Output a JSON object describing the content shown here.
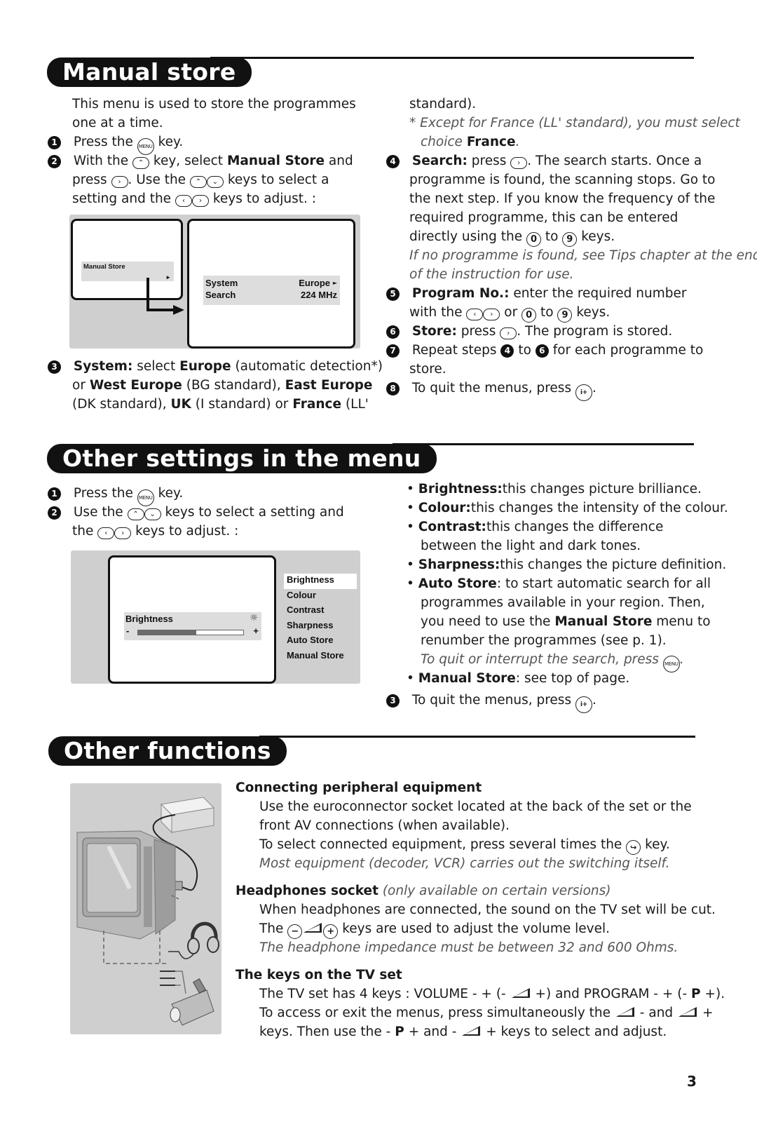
{
  "sections": {
    "manual_store": {
      "title": "Manual store",
      "intro": [
        "This menu is used to store the programmes",
        "one at a time."
      ],
      "step1": {
        "num": "1",
        "pre": "Press the",
        "key": "MENU",
        "post": "key."
      },
      "step2": {
        "num": "2",
        "line1_pre": "With the",
        "line1_mid": "key, select",
        "line1_bold": "Manual Store",
        "line1_post": "and",
        "line2_pre": "press",
        "line2_mid": ". Use the",
        "line2_post": "keys to select a",
        "line3_pre": "setting and the",
        "line3_post": "keys to adjust. :"
      },
      "diagram": {
        "left_menu_item": "Manual Store",
        "rows": [
          {
            "label": "System",
            "value": "Europe",
            "has_arrow": true
          },
          {
            "label": "Search",
            "value": "224 MHz",
            "has_arrow": false
          }
        ]
      },
      "step3": {
        "num": "3",
        "l1_b1": "System:",
        "l1_t1": "select",
        "l1_b2": "Europe",
        "l1_t2": "(automatic detection*)",
        "l2_t1": "or",
        "l2_b1": "West Europe",
        "l2_t2": "(BG standard),",
        "l2_b2": "East Europe",
        "l3_t1": "(DK standard),",
        "l3_b1": "UK",
        "l3_t2": "(I standard) or",
        "l3_b2": "France",
        "l3_t3": "(LL'",
        "l4": "standard)."
      },
      "footnote": {
        "line1": "* Except for France (LL' standard), you must select",
        "line2_pre": "choice",
        "line2_bold": "France",
        "line2_post": "."
      },
      "step4": {
        "num": "4",
        "bold": "Search:",
        "l1_pre": "press",
        "l1_post": ". The search starts. Once a",
        "l2": "programme is found, the scanning stops. Go to",
        "l3": "the next step. If you know the frequency of the",
        "l4": "required programme, this can be entered",
        "l5_pre": "directly using the",
        "key0": "0",
        "l5_mid": "to",
        "key9": "9",
        "l5_post": "keys.",
        "note1": "If no programme is found, see Tips chapter at the end",
        "note2": "of the instruction for use."
      },
      "step5": {
        "num": "5",
        "bold": "Program No.:",
        "l1": "enter the required number",
        "l2_pre": "with the",
        "l2_mid": "or",
        "key0": "0",
        "l2_to": "to",
        "key9": "9",
        "l2_post": "keys."
      },
      "step6": {
        "num": "6",
        "bold": "Store:",
        "pre": "press",
        "post": ". The program is stored."
      },
      "step7": {
        "num": "7",
        "pre": "Repeat steps",
        "from": "4",
        "mid": "to",
        "to": "6",
        "post": "for each programme to",
        "l2": "store."
      },
      "step8": {
        "num": "8",
        "pre": "To quit the menus, press",
        "key": "i+",
        "post": "."
      }
    },
    "other_settings": {
      "title": "Other settings in the menu",
      "step1": {
        "num": "1",
        "pre": "Press the",
        "key": "MENU",
        "post": "key."
      },
      "step2": {
        "num": "2",
        "l1_pre": "Use the",
        "l1_post": "keys to select a setting and",
        "l2_pre": "the",
        "l2_post": "keys to adjust. :"
      },
      "diagram": {
        "slider_label": "Brightness",
        "slider_minus": "-",
        "slider_plus": "+",
        "slider_value": 0.55,
        "menu_items": [
          "Brightness",
          "Colour",
          "Contrast",
          "Sharpness",
          "Auto Store",
          "Manual Store"
        ],
        "selected_index": 0
      },
      "bullets": [
        {
          "bold": "Brightness:",
          "text": "this changes picture brilliance."
        },
        {
          "bold": "Colour:",
          "text": "this changes the intensity of the colour."
        },
        {
          "bold": "Contrast:",
          "text": "this changes the difference",
          "text2": "between the light and dark tones."
        },
        {
          "bold": "Sharpness:",
          "text": "this changes the picture definition."
        },
        {
          "bold": "Auto Store",
          "text": ": to start automatic search for all",
          "text2": "programmes available in your region. Then,",
          "text3_pre": "you need to use the",
          "text3_bold": "Manual Store",
          "text3_post": "menu to",
          "text4": "renumber the programmes (see p. 1).",
          "note_pre": "To quit or interrupt the search, press",
          "note_key": "MENU",
          "note_post": "."
        },
        {
          "bold": "Manual Store",
          "text": ": see top of page."
        }
      ],
      "step3": {
        "num": "3",
        "pre": "To quit the menus, press",
        "key": "i+",
        "post": "."
      }
    },
    "other_functions": {
      "title": "Other functions",
      "peripheral": {
        "heading": "Connecting peripheral equipment",
        "l1": "Use the euroconnector socket located at the back of the set or the",
        "l2": "front AV connections (when available).",
        "l3_pre": "To select connected equipment, press several times the",
        "l3_post": "key.",
        "note": "Most equipment (decoder, VCR) carries out the switching itself."
      },
      "headphones": {
        "heading": "Headphones socket",
        "heading_note": "(only available on certain versions)",
        "l1": "When headphones are connected, the sound on the TV set will be cut.",
        "l2_pre": "The",
        "l2_post": "keys are used to adjust the volume level.",
        "note": "The headphone impedance must be between 32 and 600 Ohms."
      },
      "tv_keys": {
        "heading": "The keys on the TV set",
        "l1_pre": "The TV set has 4 keys : VOLUME - + (-",
        "l1_mid": "+) and PROGRAM - + (-",
        "l1_bold": "P",
        "l1_post": "+).",
        "l2_pre": "To access or exit the menus, press simultaneously the",
        "l2_mid": "- and",
        "l2_post": "+",
        "l3_pre": "keys. Then use the -",
        "l3_bold": "P",
        "l3_mid": "+ and -",
        "l3_post": "+ keys to select and adjust."
      }
    }
  },
  "page_number": "3"
}
